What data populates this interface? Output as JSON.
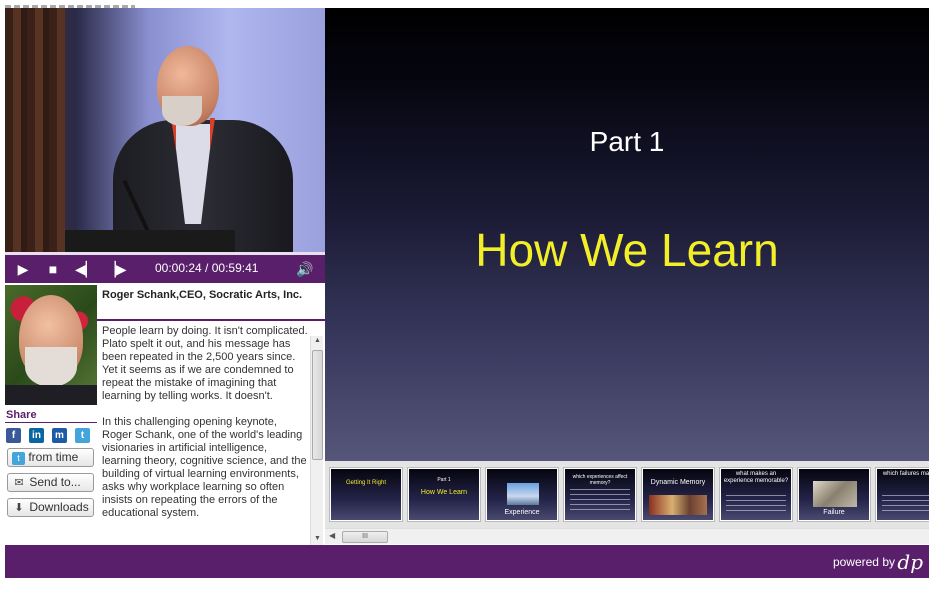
{
  "player": {
    "time_current": "00:00:24",
    "time_total": "00:59:41",
    "time_sep": " / "
  },
  "speaker": {
    "name": "Roger Schank,CEO, Socratic Arts, Inc."
  },
  "share": {
    "label": "Share",
    "social": [
      {
        "icon": "facebook-icon",
        "glyph": "f",
        "color": "#3b5998"
      },
      {
        "icon": "linkedin-icon",
        "glyph": "in",
        "color": "#0a66a2"
      },
      {
        "icon": "myspace-icon",
        "glyph": "m",
        "color": "#1d5aa8"
      },
      {
        "icon": "twitter-icon",
        "glyph": "t",
        "color": "#44a4dc"
      }
    ],
    "from_time": "from time",
    "send_to": "Send to...",
    "downloads": "Downloads"
  },
  "description": {
    "para1": "People learn by doing. It isn't complicated. Plato spelt it out, and his message has been repeated in the 2,500 years since. Yet it seems as if we are condemned to repeat the mistake of imagining that learning by telling works. It doesn't.",
    "para2": "In this challenging opening keynote, Roger Schank, one of the world's leading visionaries in artificial intelligence, learning theory, cognitive science, and the building of virtual learning environments, asks why workplace learning so often insists on repeating the errors of the educational system."
  },
  "slide": {
    "part": "Part 1",
    "title": "How We Learn"
  },
  "thumbnails": [
    {
      "title": "Getting It Right",
      "caption": ""
    },
    {
      "title": "Part 1",
      "caption": "How We Learn"
    },
    {
      "title": "",
      "caption": "Experience"
    },
    {
      "title": "which experiences affect memory?",
      "caption": ""
    },
    {
      "title": "",
      "caption": "Dynamic Memory"
    },
    {
      "title": "what makes an experience memorable?",
      "caption": ""
    },
    {
      "title": "",
      "caption": "Failure"
    },
    {
      "title": "which failures matter?",
      "caption": ""
    }
  ],
  "footer": {
    "powered_by": "powered by"
  }
}
